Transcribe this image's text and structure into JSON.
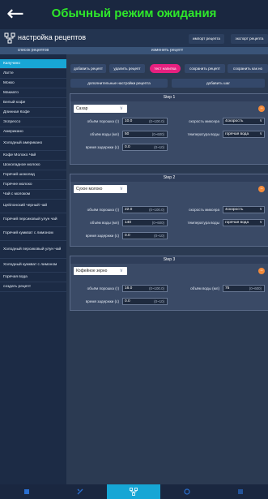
{
  "header": {
    "title": "Обычный режим ожидания",
    "back_icon": "back-arrow-icon"
  },
  "subbar": {
    "title": "настройка рецептов",
    "import_label": "импорт рецепта",
    "export_label": "экспорт рецепта"
  },
  "sidebar": {
    "header": "список рецептов",
    "items": [
      "Капучино",
      "Латте",
      "Мокко",
      "Макиато",
      "Белый кофе",
      "Длинная Кофе",
      "Эспрессо",
      "Американо",
      "Холодный американо",
      "Кофе Молоко Чай",
      "Шоколадное молоко",
      "Горячий шоколад",
      "Горячее молоко",
      "Чай с молоком",
      "Цейлонский черный чай",
      "Горячий персиковый улун чай",
      "Горячий кумкват с лимоном",
      "Холодный персиковый улун чай",
      "Холодный кумкват с лимоном",
      "Горячая вода",
      "создать рецепт"
    ],
    "active_index": 0
  },
  "main": {
    "header": "изменить рецепт",
    "buttons": {
      "add_recipe": "добавить рецепт",
      "delete_recipe": "удалить рецепт",
      "drink_test": "тест напитка",
      "save_recipe": "сохранить рецепт",
      "save_as": "сохранить как но",
      "advanced": "дополнительные настройки рецепта",
      "add_step": "добавить шаг"
    },
    "labels": {
      "powder": "объём порошка (г)",
      "water": "объём воды (мл)",
      "delay": "время задержки (с)",
      "mixer": "скорость миксера",
      "water_temp": "температура воды"
    },
    "steps": [
      {
        "title": "Step 1",
        "ingredient": "Сахар",
        "powder": "10.0",
        "powder_range": "(0~100.0)",
        "water": "50",
        "water_range": "(0~600)",
        "delay": "0.0",
        "delay_range": "(0~10)",
        "mixer": "4скорость",
        "temp": "горячая вода"
      },
      {
        "title": "Step 2",
        "ingredient": "Сухое молоко",
        "powder": "22.0",
        "powder_range": "(0~100.0)",
        "water": "140",
        "water_range": "(0~600)",
        "delay": "0.0",
        "delay_range": "(0~10)",
        "mixer": "4скорость",
        "temp": "горячая вода"
      },
      {
        "title": "Step 3",
        "ingredient": "Кофейное зерно",
        "powder": "16.0",
        "powder_range": "(0~100.0)",
        "water": "75",
        "water_range": "(0~600)",
        "delay": "0.0",
        "delay_range": "(0~10)"
      }
    ]
  },
  "bottom_tabs": [
    "home-icon",
    "tools-icon",
    "recipe-icon",
    "maintenance-icon",
    "list-icon"
  ],
  "colors": {
    "title_green": "#2ee82a",
    "accent_blue": "#18a6d6",
    "pink": "#e6207f",
    "remove_orange": "#f28a3a"
  }
}
